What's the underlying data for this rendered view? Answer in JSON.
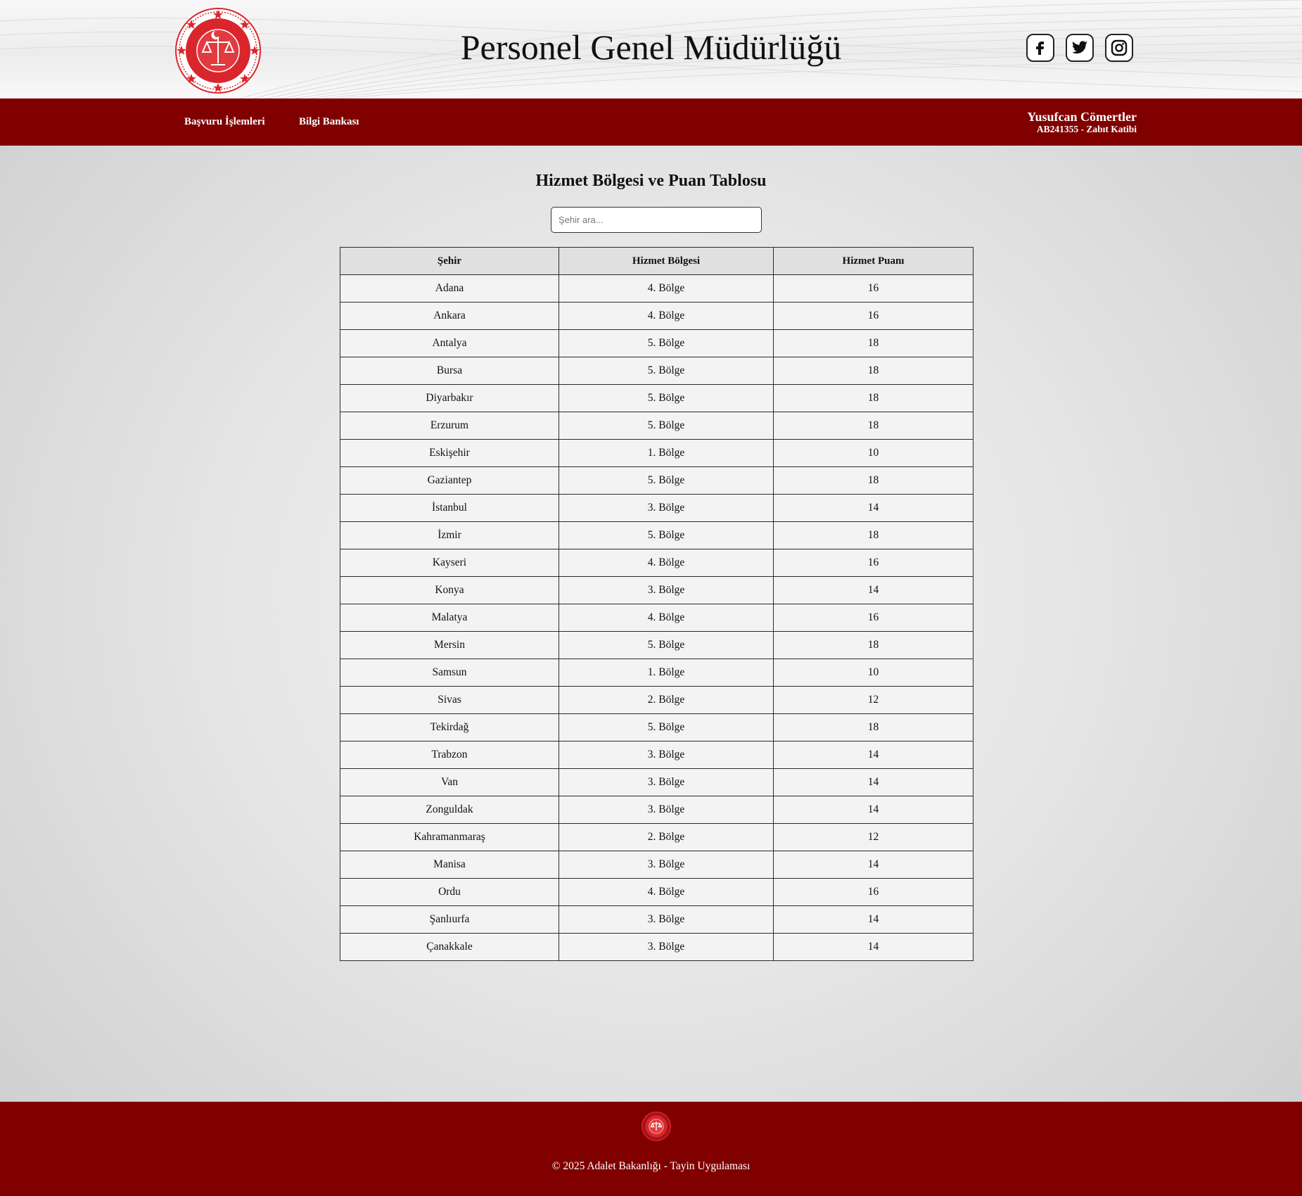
{
  "header": {
    "title": "Personel Genel Müdürlüğü",
    "logo_icon": "adalet-bakanligi-emblem-icon",
    "socials": [
      {
        "name": "Facebook",
        "icon": "facebook-icon"
      },
      {
        "name": "Twitter",
        "icon": "twitter-icon"
      },
      {
        "name": "Instagram",
        "icon": "instagram-icon"
      }
    ]
  },
  "nav": {
    "items": [
      {
        "label": "Başvuru İşlemleri"
      },
      {
        "label": "Bilgi Bankası"
      }
    ],
    "user": {
      "name": "Yusufcan Cömertler",
      "detail": "AB241355 - Zabıt Katibi"
    }
  },
  "main": {
    "heading": "Hizmet Bölgesi ve Puan Tablosu",
    "search": {
      "placeholder": "Şehir ara...",
      "value": ""
    },
    "table": {
      "headers": [
        "Şehir",
        "Hizmet Bölgesi",
        "Hizmet Puanı"
      ],
      "rows": [
        [
          "Adana",
          "4. Bölge",
          "16"
        ],
        [
          "Ankara",
          "4. Bölge",
          "16"
        ],
        [
          "Antalya",
          "5. Bölge",
          "18"
        ],
        [
          "Bursa",
          "5. Bölge",
          "18"
        ],
        [
          "Diyarbakır",
          "5. Bölge",
          "18"
        ],
        [
          "Erzurum",
          "5. Bölge",
          "18"
        ],
        [
          "Eskişehir",
          "1. Bölge",
          "10"
        ],
        [
          "Gaziantep",
          "5. Bölge",
          "18"
        ],
        [
          "İstanbul",
          "3. Bölge",
          "14"
        ],
        [
          "İzmir",
          "5. Bölge",
          "18"
        ],
        [
          "Kayseri",
          "4. Bölge",
          "16"
        ],
        [
          "Konya",
          "3. Bölge",
          "14"
        ],
        [
          "Malatya",
          "4. Bölge",
          "16"
        ],
        [
          "Mersin",
          "5. Bölge",
          "18"
        ],
        [
          "Samsun",
          "1. Bölge",
          "10"
        ],
        [
          "Sivas",
          "2. Bölge",
          "12"
        ],
        [
          "Tekirdağ",
          "5. Bölge",
          "18"
        ],
        [
          "Trabzon",
          "3. Bölge",
          "14"
        ],
        [
          "Van",
          "3. Bölge",
          "14"
        ],
        [
          "Zonguldak",
          "3. Bölge",
          "14"
        ],
        [
          "Kahramanmaraş",
          "2. Bölge",
          "12"
        ],
        [
          "Manisa",
          "3. Bölge",
          "14"
        ],
        [
          "Ordu",
          "4. Bölge",
          "16"
        ],
        [
          "Şanlıurfa",
          "3. Bölge",
          "14"
        ],
        [
          "Çanakkale",
          "3. Bölge",
          "14"
        ]
      ]
    }
  },
  "footer": {
    "logo_icon": "adalet-bakanligi-emblem-icon",
    "text": "© 2025 Adalet Bakanlığı - Tayin Uygulaması"
  },
  "colors": {
    "brand": "#800000",
    "emblem": "#d9262c"
  }
}
